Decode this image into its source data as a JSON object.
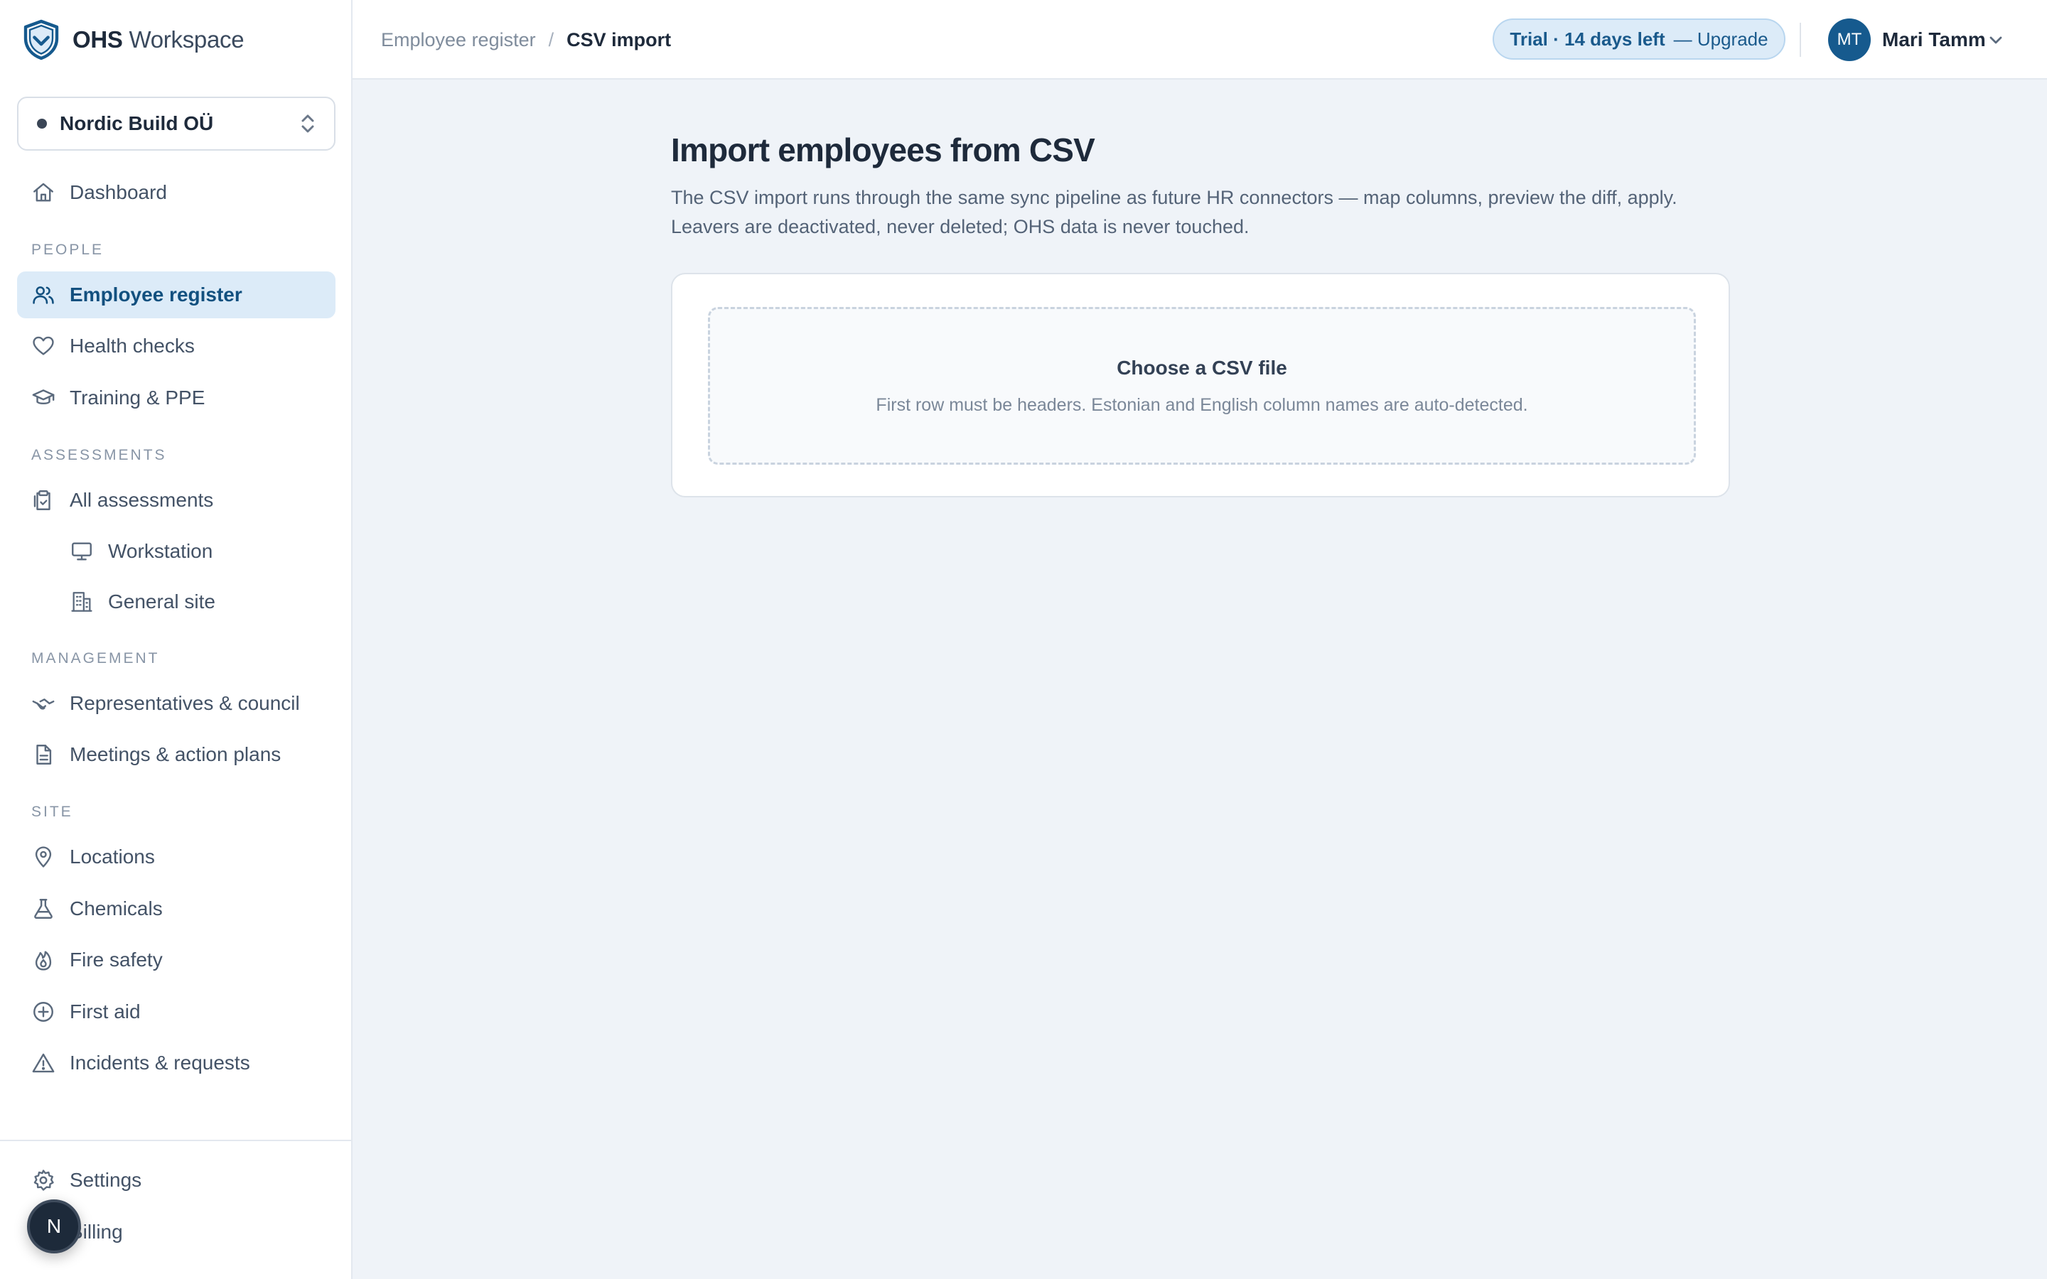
{
  "brand": {
    "name_bold": "OHS",
    "name_light": "Workspace"
  },
  "org": {
    "name": "Nordic Build OÜ"
  },
  "nav": {
    "dashboard": "Dashboard",
    "sections": {
      "people": "PEOPLE",
      "assessments": "ASSESSMENTS",
      "management": "MANAGEMENT",
      "site": "SITE"
    },
    "employee_register": "Employee register",
    "health_checks": "Health checks",
    "training_ppe": "Training & PPE",
    "all_assessments": "All assessments",
    "workstation": "Workstation",
    "general_site": "General site",
    "representatives": "Representatives & council",
    "meetings": "Meetings & action plans",
    "locations": "Locations",
    "chemicals": "Chemicals",
    "fire_safety": "Fire safety",
    "first_aid": "First aid",
    "incidents": "Incidents & requests",
    "settings": "Settings",
    "billing": "Billing"
  },
  "fab": {
    "label": "N"
  },
  "breadcrumb": {
    "parent": "Employee register",
    "separator": "/",
    "current": "CSV import"
  },
  "trial": {
    "text": "Trial · 14 days left",
    "cta": "— Upgrade"
  },
  "user": {
    "initials": "MT",
    "name": "Mari Tamm"
  },
  "main": {
    "title": "Import employees from CSV",
    "description": "The CSV import runs through the same sync pipeline as future HR connectors — map columns, preview the diff, apply. Leavers are deactivated, never deleted; OHS data is never touched.",
    "dropzone": {
      "title": "Choose a CSV file",
      "hint": "First row must be headers. Estonian and English column names are auto-detected."
    }
  },
  "colors": {
    "accent": "#165a8e",
    "active_bg": "#dcebf8",
    "page_bg": "#eff3f8"
  }
}
